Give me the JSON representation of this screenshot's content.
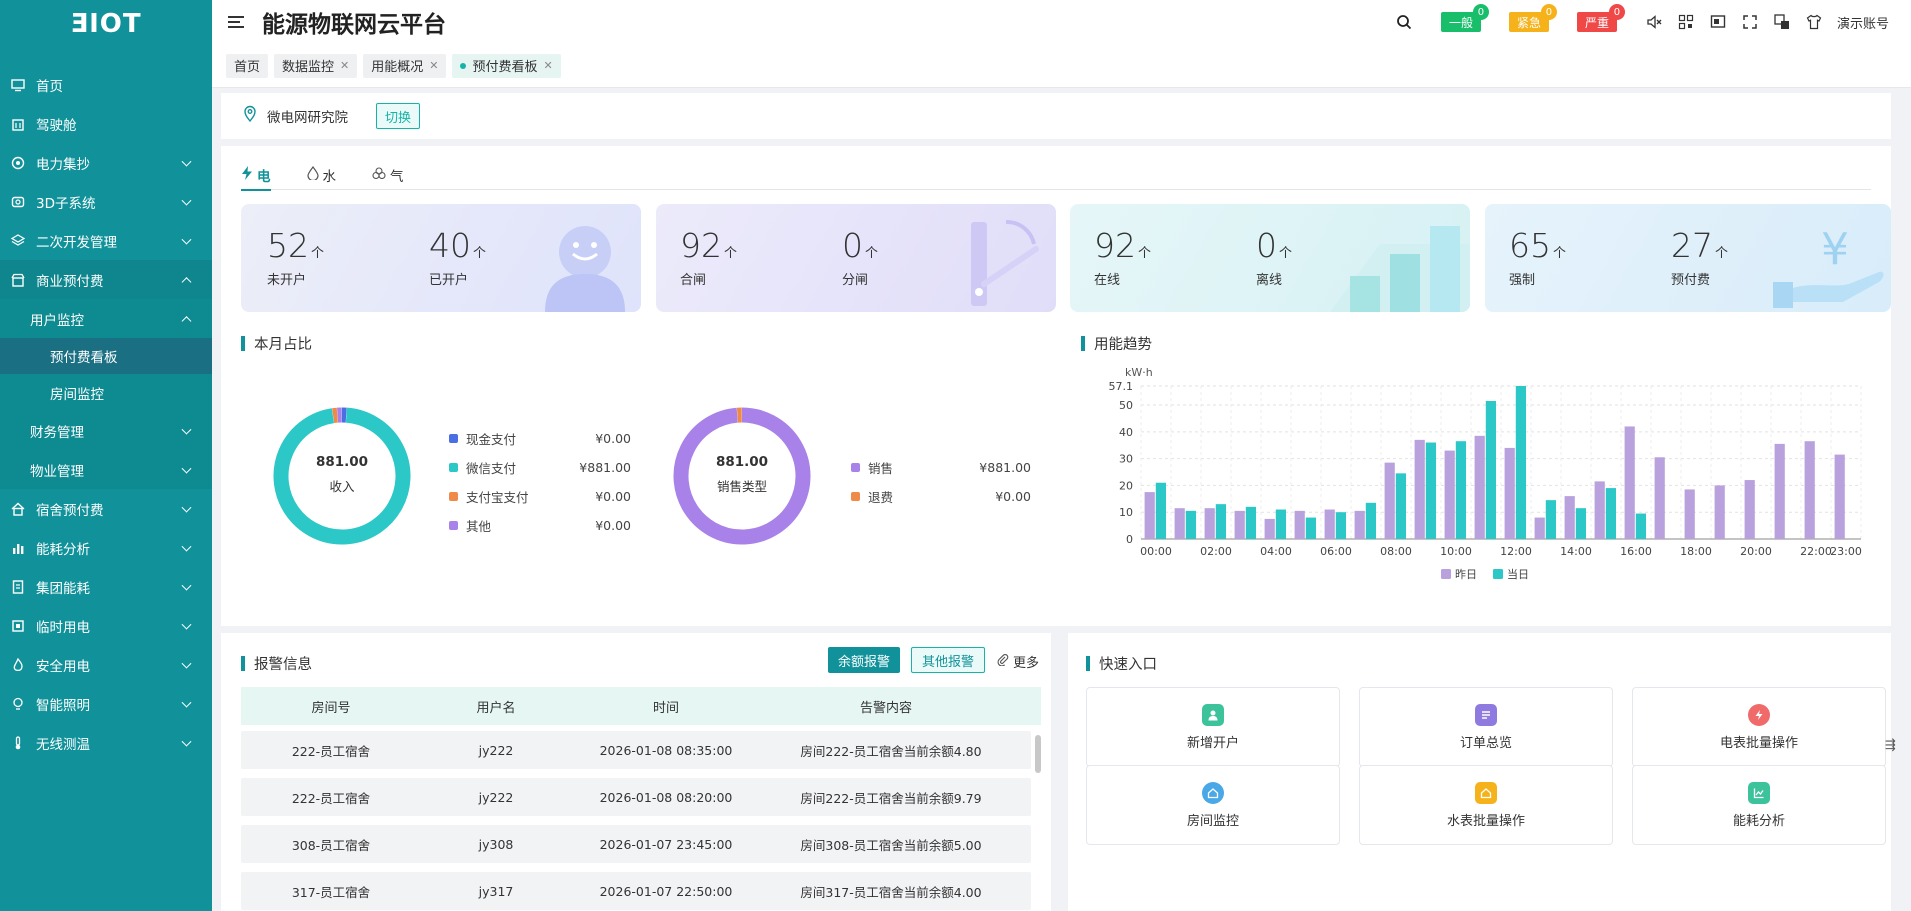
{
  "app": {
    "logo": "ƎIOT",
    "title": "能源物联网云平台"
  },
  "sidebar": {
    "items": [
      {
        "label": "首页",
        "icon": "monitor-icon"
      },
      {
        "label": "驾驶舱",
        "icon": "building-icon"
      },
      {
        "label": "电力集抄",
        "icon": "meter-icon"
      },
      {
        "label": "3D子系统",
        "icon": "cube-icon"
      },
      {
        "label": "二次开发管理",
        "icon": "layers-icon"
      },
      {
        "label": "商业预付费",
        "icon": "shop-icon"
      },
      {
        "label": "用户监控"
      },
      {
        "label": "预付费看板"
      },
      {
        "label": "房间监控"
      },
      {
        "label": "财务管理"
      },
      {
        "label": "物业管理"
      },
      {
        "label": "宿舍预付费",
        "icon": "home-icon"
      },
      {
        "label": "能耗分析",
        "icon": "bar-chart-icon"
      },
      {
        "label": "集团能耗",
        "icon": "document-icon"
      },
      {
        "label": "临时用电",
        "icon": "plug-icon"
      },
      {
        "label": "安全用电",
        "icon": "flame-icon"
      },
      {
        "label": "智能照明",
        "icon": "bulb-icon"
      },
      {
        "label": "无线测温",
        "icon": "thermometer-icon"
      }
    ]
  },
  "header": {
    "alerts": [
      {
        "label": "一般",
        "count": "0",
        "color": "#19be6b"
      },
      {
        "label": "紧急",
        "count": "0",
        "color": "#f5b21b"
      },
      {
        "label": "严重",
        "count": "0",
        "color": "#f04747"
      }
    ],
    "account": "演示账号"
  },
  "tabs": [
    {
      "label": "首页",
      "closable": false
    },
    {
      "label": "数据监控",
      "closable": true
    },
    {
      "label": "用能概况",
      "closable": true
    },
    {
      "label": "预付费看板",
      "closable": true,
      "active": true
    }
  ],
  "location": {
    "name": "微电网研究院",
    "switch_label": "切换"
  },
  "energy_tabs": [
    {
      "label": "电",
      "icon": "bolt-icon"
    },
    {
      "label": "水",
      "icon": "drop-icon"
    },
    {
      "label": "气",
      "icon": "gas-icon"
    }
  ],
  "cards": [
    {
      "a": {
        "value": "52",
        "unit": "个",
        "label": "未开户"
      },
      "b": {
        "value": "40",
        "unit": "个",
        "label": "已开户"
      }
    },
    {
      "a": {
        "value": "92",
        "unit": "个",
        "label": "合闸"
      },
      "b": {
        "value": "0",
        "unit": "个",
        "label": "分闸"
      }
    },
    {
      "a": {
        "value": "92",
        "unit": "个",
        "label": "在线"
      },
      "b": {
        "value": "0",
        "unit": "个",
        "label": "离线"
      }
    },
    {
      "a": {
        "value": "65",
        "unit": "个",
        "label": "强制"
      },
      "b": {
        "value": "27",
        "unit": "个",
        "label": "预付费"
      }
    }
  ],
  "ratio": {
    "title": "本月占比",
    "donut1": {
      "center_value": "881.00",
      "center_label": "收入",
      "items": [
        {
          "label": "现金支付",
          "value": "¥0.00",
          "amount": 0,
          "color": "#4a6fe3"
        },
        {
          "label": "微信支付",
          "value": "¥881.00",
          "amount": 881,
          "color": "#2cc7c7"
        },
        {
          "label": "支付宝支付",
          "value": "¥0.00",
          "amount": 0,
          "color": "#ef8a48"
        },
        {
          "label": "其他",
          "value": "¥0.00",
          "amount": 0,
          "color": "#a882e8"
        }
      ]
    },
    "donut2": {
      "center_value": "881.00",
      "center_label": "销售类型",
      "items": [
        {
          "label": "销售",
          "value": "¥881.00",
          "amount": 881,
          "color": "#a882e8"
        },
        {
          "label": "退费",
          "value": "¥0.00",
          "amount": 0,
          "color": "#ef8a48"
        }
      ]
    }
  },
  "trend": {
    "title": "用能趋势"
  },
  "chart_data": {
    "type": "bar",
    "ylabel": "kW·h",
    "ylim": [
      0,
      57.1
    ],
    "yticks": [
      "0",
      "10",
      "20",
      "30",
      "40",
      "50",
      "57.1"
    ],
    "categories": [
      "00:00",
      "01:00",
      "02:00",
      "03:00",
      "04:00",
      "05:00",
      "06:00",
      "07:00",
      "08:00",
      "09:00",
      "10:00",
      "11:00",
      "12:00",
      "13:00",
      "14:00",
      "15:00",
      "16:00",
      "17:00",
      "18:00",
      "19:00",
      "20:00",
      "21:00",
      "22:00",
      "23:00"
    ],
    "xtick_labels": [
      "00:00",
      "02:00",
      "04:00",
      "06:00",
      "08:00",
      "10:00",
      "12:00",
      "14:00",
      "16:00",
      "18:00",
      "20:00",
      "22:00",
      "23:00"
    ],
    "series": [
      {
        "name": "昨日",
        "color": "#b8a1dc",
        "values": [
          17.5,
          11.5,
          11.5,
          10.5,
          7.5,
          10.5,
          11,
          10.5,
          28.5,
          37,
          33,
          38.5,
          34,
          8,
          16,
          21.5,
          42,
          30.5,
          18.5,
          20,
          22,
          35.5,
          36.5,
          31.5
        ]
      },
      {
        "name": "当日",
        "color": "#2cc7c7",
        "values": [
          21,
          10.5,
          13,
          12,
          11,
          8,
          10,
          13.5,
          24.5,
          36,
          36.5,
          51.5,
          57.1,
          14.5,
          11.5,
          19,
          9.5,
          null,
          null,
          null,
          null,
          null,
          null,
          null
        ]
      }
    ],
    "grid": true,
    "legend": "bottom"
  },
  "alarms": {
    "title": "报警信息",
    "btn_balance": "余额报警",
    "btn_other": "其他报警",
    "more": "更多",
    "columns": [
      "房间号",
      "用户名",
      "时间",
      "告警内容"
    ],
    "rows": [
      [
        "222-员工宿舍",
        "jy222",
        "2026-01-08 08:35:00",
        "房间222-员工宿舍当前余额4.80"
      ],
      [
        "222-员工宿舍",
        "jy222",
        "2026-01-08 08:20:00",
        "房间222-员工宿舍当前余额9.79"
      ],
      [
        "308-员工宿舍",
        "jy308",
        "2026-01-07 23:45:00",
        "房间308-员工宿舍当前余额5.00"
      ],
      [
        "317-员工宿舍",
        "jy317",
        "2026-01-07 22:50:00",
        "房间317-员工宿舍当前余额4.00"
      ]
    ]
  },
  "quick": {
    "title": "快速入口",
    "items": [
      {
        "label": "新增开户",
        "color": "#3cc39c"
      },
      {
        "label": "订单总览",
        "color": "#8f7be0"
      },
      {
        "label": "电表批量操作",
        "color": "#f06a6a"
      },
      {
        "label": "房间监控",
        "color": "#4aa8e6"
      },
      {
        "label": "水表批量操作",
        "color": "#f5b21b"
      },
      {
        "label": "能耗分析",
        "color": "#3cc39c"
      }
    ]
  }
}
